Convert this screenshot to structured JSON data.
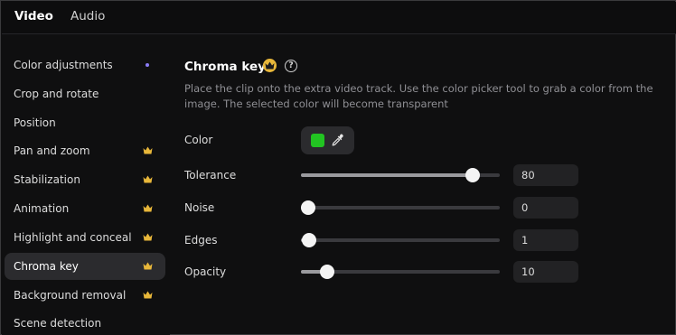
{
  "tabs": {
    "video": "Video",
    "audio": "Audio"
  },
  "sidebar": {
    "items": [
      {
        "label": "Color adjustments",
        "marker": "dot"
      },
      {
        "label": "Crop and rotate",
        "marker": ""
      },
      {
        "label": "Position",
        "marker": ""
      },
      {
        "label": "Pan and zoom",
        "marker": "crown"
      },
      {
        "label": "Stabilization",
        "marker": "crown"
      },
      {
        "label": "Animation",
        "marker": "crown"
      },
      {
        "label": "Highlight and conceal",
        "marker": "crown"
      },
      {
        "label": "Chroma key",
        "marker": "crown",
        "active": true
      },
      {
        "label": "Background removal",
        "marker": "crown"
      },
      {
        "label": "Scene detection",
        "marker": ""
      }
    ]
  },
  "panel": {
    "title": "Chroma key",
    "help_symbol": "?",
    "description": "Place the clip onto the extra video track. Use the color picker tool to grab a color from the image. The selected color will become transparent",
    "color": {
      "label": "Color",
      "swatch": "#22c422",
      "tool_icon": "eyedropper-icon"
    },
    "sliders": [
      {
        "label": "Tolerance",
        "value": "80",
        "level": 0.865
      },
      {
        "label": "Noise",
        "value": "0",
        "level": 0.03
      },
      {
        "label": "Edges",
        "value": "1",
        "level": 0.04
      },
      {
        "label": "Opacity",
        "value": "10",
        "level": 0.13
      }
    ]
  },
  "colors": {
    "accent_dot": "#8b7cf6",
    "crown": "#e8b73a",
    "background": "#0f0f10",
    "active_item": "#2b2b2e"
  }
}
